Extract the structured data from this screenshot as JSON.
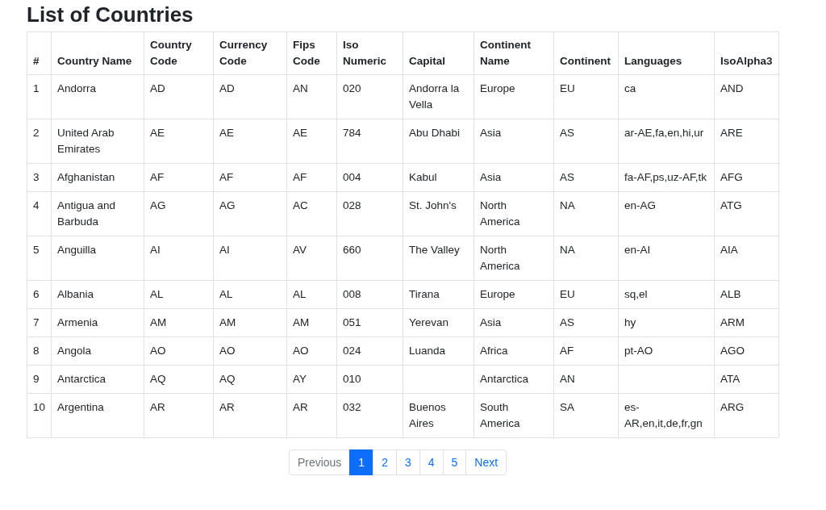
{
  "title": "List of Countries",
  "table": {
    "columns": [
      "#",
      "Country Name",
      "Country Code",
      "Currency Code",
      "Fips Code",
      "Iso Numeric",
      "Capital",
      "Continent Name",
      "Continent",
      "Languages",
      "IsoAlpha3"
    ],
    "rows": [
      [
        "1",
        "Andorra",
        "AD",
        "AD",
        "AN",
        "020",
        "Andorra la Vella",
        "Europe",
        "EU",
        "ca",
        "AND"
      ],
      [
        "2",
        "United Arab Emirates",
        "AE",
        "AE",
        "AE",
        "784",
        "Abu Dhabi",
        "Asia",
        "AS",
        "ar-AE,fa,en,hi,ur",
        "ARE"
      ],
      [
        "3",
        "Afghanistan",
        "AF",
        "AF",
        "AF",
        "004",
        "Kabul",
        "Asia",
        "AS",
        "fa-AF,ps,uz-AF,tk",
        "AFG"
      ],
      [
        "4",
        "Antigua and Barbuda",
        "AG",
        "AG",
        "AC",
        "028",
        "St. John's",
        "North America",
        "NA",
        "en-AG",
        "ATG"
      ],
      [
        "5",
        "Anguilla",
        "AI",
        "AI",
        "AV",
        "660",
        "The Valley",
        "North America",
        "NA",
        "en-AI",
        "AIA"
      ],
      [
        "6",
        "Albania",
        "AL",
        "AL",
        "AL",
        "008",
        "Tirana",
        "Europe",
        "EU",
        "sq,el",
        "ALB"
      ],
      [
        "7",
        "Armenia",
        "AM",
        "AM",
        "AM",
        "051",
        "Yerevan",
        "Asia",
        "AS",
        "hy",
        "ARM"
      ],
      [
        "8",
        "Angola",
        "AO",
        "AO",
        "AO",
        "024",
        "Luanda",
        "Africa",
        "AF",
        "pt-AO",
        "AGO"
      ],
      [
        "9",
        "Antarctica",
        "AQ",
        "AQ",
        "AY",
        "010",
        "",
        "Antarctica",
        "AN",
        "",
        "ATA"
      ],
      [
        "10",
        "Argentina",
        "AR",
        "AR",
        "AR",
        "032",
        "Buenos Aires",
        "South America",
        "SA",
        "es-AR,en,it,de,fr,gn",
        "ARG"
      ]
    ]
  },
  "pagination": [
    {
      "label": "Previous",
      "selected": false,
      "disabled": true
    },
    {
      "label": "1",
      "selected": true,
      "disabled": false
    },
    {
      "label": "2",
      "selected": false,
      "disabled": false
    },
    {
      "label": "3",
      "selected": false,
      "disabled": false
    },
    {
      "label": "4",
      "selected": false,
      "disabled": false
    },
    {
      "label": "5",
      "selected": false,
      "disabled": false
    },
    {
      "label": "Next",
      "selected": false,
      "disabled": false
    }
  ]
}
